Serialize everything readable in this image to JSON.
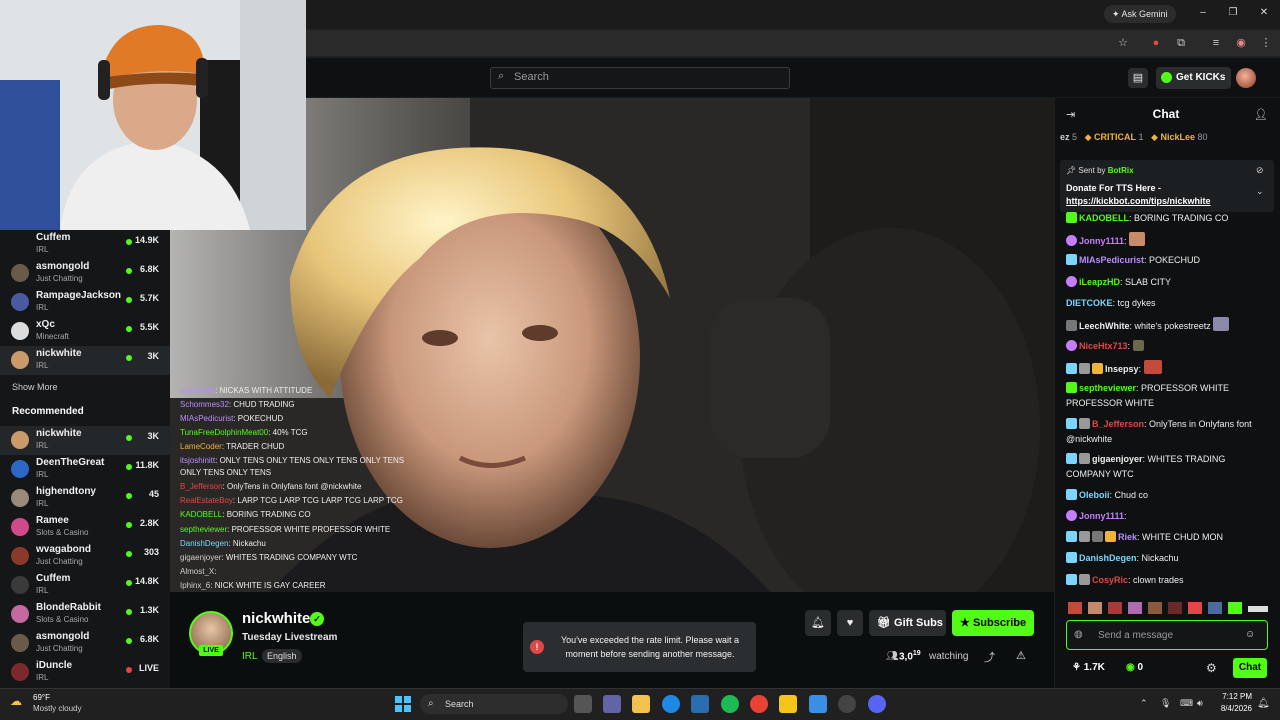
{
  "browser": {
    "ask_gemini": "Ask Gemini"
  },
  "header": {
    "search_placeholder": "Search",
    "get_kicks": "Get KICKs"
  },
  "sidebar": {
    "following": [
      {
        "name": "Cuffem",
        "category": "IRL",
        "viewers": "14.9K"
      },
      {
        "name": "asmongold",
        "category": "Just Chatting",
        "viewers": "6.8K"
      },
      {
        "name": "RampageJackson",
        "category": "IRL",
        "viewers": "5.7K"
      },
      {
        "name": "xQc",
        "category": "Minecraft",
        "viewers": "5.5K"
      },
      {
        "name": "nickwhite",
        "category": "IRL",
        "viewers": "3K"
      }
    ],
    "show_more": "Show More",
    "recommended_title": "Recommended",
    "recommended": [
      {
        "name": "nickwhite",
        "category": "IRL",
        "viewers": "3K"
      },
      {
        "name": "DeenTheGreat",
        "category": "IRL",
        "viewers": "11.8K"
      },
      {
        "name": "highendtony",
        "category": "IRL",
        "viewers": "45"
      },
      {
        "name": "Ramee",
        "category": "Slots & Casino",
        "viewers": "2.8K"
      },
      {
        "name": "wvagabond",
        "category": "Just Chatting",
        "viewers": "303"
      },
      {
        "name": "Cuffem",
        "category": "IRL",
        "viewers": "14.8K"
      },
      {
        "name": "BlondeRabbit",
        "category": "Slots & Casino",
        "viewers": "1.3K"
      },
      {
        "name": "asmongold",
        "category": "Just Chatting",
        "viewers": "6.8K"
      },
      {
        "name": "iDuncle",
        "category": "IRL",
        "viewers": "LIVE"
      }
    ]
  },
  "overlay_chat": [
    {
      "user": "mitchmillz",
      "text": ": NICKAS WITH ATTITUDE",
      "color": "#b98cff"
    },
    {
      "user": "Schommes32",
      "text": ": CHUD TRADING",
      "color": "#b98cff"
    },
    {
      "user": "MIAsPedicurist",
      "text": ": POKECHUD",
      "color": "#b98cff"
    },
    {
      "user": "TunaFreeDolphinMeat00",
      "text": ": 40% TCG",
      "color": "#53fc18"
    },
    {
      "user": "LameCoder",
      "text": ": TRADER CHUD",
      "color": "#f0b43a"
    },
    {
      "user": "itsjoshinitt",
      "text": ": ONLY TENS   ONLY TENS   ONLY TENS   ONLY TENS",
      "color": "#b98cff"
    },
    {
      "user": "",
      "text": "ONLY TENS   ONLY TENS",
      "color": "#eeeeee"
    },
    {
      "user": "B_Jefferson",
      "text": ": OnlyTens in Onlyfans font @nickwhite",
      "color": "#e24646"
    },
    {
      "user": "RealEstateBoy",
      "text": ": LARP TCG   LARP TCG   LARP TCG   LARP TCG",
      "color": "#e24646"
    },
    {
      "user": "KADOBELL",
      "text": ": BORING TRADING CO",
      "color": "#53fc18"
    },
    {
      "user": "septheviewer",
      "text": ": PROFESSOR WHITE   PROFESSOR WHITE",
      "color": "#53fc18"
    },
    {
      "user": "DanishDegen",
      "text": ": Nickachu",
      "color": "#7ad6ff"
    },
    {
      "user": "gigaenjoyer",
      "text": ": WHITES TRADING COMPANY WTC",
      "color": "#cfcfcf"
    },
    {
      "user": "Almost_X",
      "text": ":",
      "color": "#cfcfcf"
    },
    {
      "user": "Iphinx_6",
      "text": ": NICK WHITE IS GAY CAREER",
      "color": "#cfcfcf"
    }
  ],
  "stream": {
    "streamer": "nickwhite",
    "live_label": "LIVE",
    "title": "Tuesday Livestream",
    "category": "IRL",
    "language": "English",
    "rate_limit_msg": "You've exceeded the rate limit. Please wait a moment before sending another message.",
    "gift_subs": "Gift Subs",
    "subscribe": "Subscribe",
    "viewer_count": "3,0",
    "viewer_count_sup": "19",
    "watching": "watching"
  },
  "chat": {
    "title": "Chat",
    "leaderboard": [
      {
        "name": "ez",
        "count": "5",
        "color": "#cfcfcf"
      },
      {
        "name": "CRITICAL",
        "count": "1",
        "color": "#f0b43a"
      },
      {
        "name": "NickLee",
        "count": "80",
        "color": "#f0b43a"
      }
    ],
    "pinned_sent_by": "Sent by",
    "pinned_bot": "BotRix",
    "pinned_text": "Donate For TTS Here -",
    "pinned_link": "https://kickbot.com/tips/nickwhite",
    "messages": [
      {
        "user": "KADOBELL",
        "text": ": BORING TRADING CO",
        "color": "#53fc18"
      },
      {
        "user": "Jonny1111",
        "text": ":",
        "color": "#c77dff"
      },
      {
        "user": "MIAsPedicurist",
        "text": ": POKECHUD",
        "color": "#b98cff"
      },
      {
        "user": "iLeapzHD",
        "text": ": SLAB CITY",
        "color": "#53fc18"
      },
      {
        "user": "DIETCOKE",
        "text": ": tcg dykes",
        "color": "#7ad6ff"
      },
      {
        "user": "LeechWhite",
        "text": ": white's pokestreetz",
        "color": "#eeeeee"
      },
      {
        "user": "NiceHtx713",
        "text": ":",
        "color": "#e24646"
      },
      {
        "user": "Insepsy",
        "text": ":",
        "color": "#eeeeee"
      },
      {
        "user": "septheviewer",
        "text": ": PROFESSOR WHITE PROFESSOR WHITE",
        "color": "#53fc18"
      },
      {
        "user": "B_Jefferson",
        "text": ": OnlyTens in Onlyfans font @nickwhite",
        "color": "#e24646"
      },
      {
        "user": "gigaenjoyer",
        "text": ": WHITES TRADING COMPANY WTC",
        "color": "#eeeeee"
      },
      {
        "user": "Oleboii",
        "text": ": Chud co",
        "color": "#7ad6ff"
      },
      {
        "user": "Jonny1111",
        "text": ":",
        "color": "#c77dff"
      },
      {
        "user": "Riek",
        "text": ": WHITE CHUD MON",
        "color": "#b98cff"
      },
      {
        "user": "DanishDegen",
        "text": ": Nickachu",
        "color": "#7ad6ff"
      },
      {
        "user": "CosyRic",
        "text": ": clown trades",
        "color": "#e24646"
      }
    ],
    "input_placeholder": "Send a message",
    "kicks_balance": "1.7K",
    "points": "0",
    "send_label": "Chat"
  },
  "taskbar": {
    "weather_temp": "69°F",
    "weather_desc": "Mostly cloudy",
    "search_label": "Search",
    "time": "7:12 PM",
    "date": "8/4/2026"
  }
}
